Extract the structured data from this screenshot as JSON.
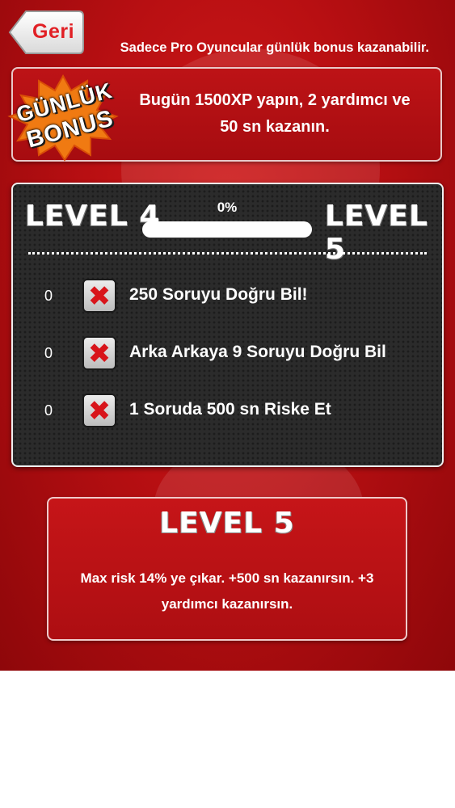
{
  "header": {
    "back_label": "Geri",
    "notice": "Sadece Pro Oyuncular günlük bonus kazanabilir."
  },
  "daily_bonus": {
    "badge_line1": "GÜNLÜK",
    "badge_line2": "BONUS",
    "text_line1": "Bugün 1500XP yapın, 2 yardımcı ve",
    "text_line2": "50 sn kazanın."
  },
  "level_progress": {
    "current_level": "LEVEL 4",
    "next_level": "LEVEL 5",
    "percent_label": "0%",
    "percent": 0
  },
  "tasks": [
    {
      "count": "0",
      "label": "250 Soruyu Doğru Bil!",
      "status_icon": "x-mark-icon"
    },
    {
      "count": "0",
      "label": "Arka Arkaya 9 Soruyu Doğru Bil",
      "status_icon": "x-mark-icon"
    },
    {
      "count": "0",
      "label": "1 Soruda 500 sn Riske Et",
      "status_icon": "x-mark-icon"
    }
  ],
  "next_level_reward": {
    "title": "LEVEL 5",
    "text_line1": "Max risk 14% ye çıkar. +500 sn kazanırsın. +3",
    "text_line2": "yardımcı kazanırsın."
  },
  "colors": {
    "background": "#b80f12",
    "accent_red": "#e12025",
    "panel_dark": "#2b2b2b",
    "text": "#ffffff"
  }
}
